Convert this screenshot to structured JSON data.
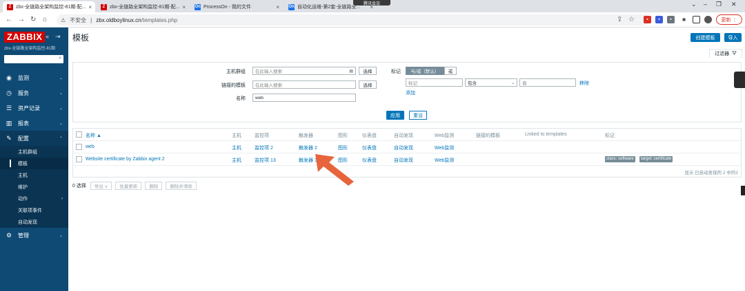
{
  "browser": {
    "tabs": [
      {
        "title": "zbx-全链路全架构监控-81期-配...",
        "favicon": "Z",
        "color": "#d40000"
      },
      {
        "title": "zbx-全链路全架构监控-81期-配...",
        "favicon": "Z",
        "color": "#d40000"
      },
      {
        "title": "ProcessOn - 我的文件",
        "favicon": "On",
        "color": "#1a73e8"
      },
      {
        "title": "自动化运维-第2套-全链路全...",
        "favicon": "On",
        "color": "#1a73e8"
      }
    ],
    "meeting_label": "腾讯会议",
    "insecure_label": "不安全",
    "url_domain": "zbx.oldboylinux.cn",
    "url_path": "/templates.php",
    "update_label": "更新"
  },
  "sidebar": {
    "logo": "ZABBIX",
    "subtitle": "zbx-全链路全架构监控-81期",
    "menu": [
      {
        "label": "监测",
        "icon": "eye-icon"
      },
      {
        "label": "服务",
        "icon": "clock-icon"
      },
      {
        "label": "资产记录",
        "icon": "list-icon"
      },
      {
        "label": "报表",
        "icon": "chart-icon"
      },
      {
        "label": "配置",
        "icon": "wrench-icon"
      }
    ],
    "submenu": [
      "主机群组",
      "模板",
      "主机",
      "维护",
      "动作",
      "关联项事件",
      "自动发现"
    ],
    "admin": {
      "label": "管理",
      "icon": "gear-icon"
    }
  },
  "page": {
    "title": "模板",
    "create_button": "创建模板",
    "import_button": "导入",
    "filter_tab": "过滤器"
  },
  "filter": {
    "host_groups_label": "主机群组",
    "host_groups_placeholder": "在此输入搜索",
    "linked_templates_label": "链接的模板",
    "linked_templates_placeholder": "在此输入搜索",
    "select_button": "选择",
    "name_label": "名称",
    "name_value": "web",
    "tags_label": "标记",
    "and_or": "与/或（默认）",
    "or": "或",
    "tag_placeholder": "标记",
    "tag_operator": "包含",
    "value_placeholder": "值",
    "remove_link": "移除",
    "add_link": "添加",
    "apply_button": "应用",
    "reset_button": "重设"
  },
  "table": {
    "headers": [
      "名称 ▲",
      "主机",
      "监控项",
      "触发器",
      "图形",
      "仪表盘",
      "自动发现",
      "Web监测",
      "链接的模板",
      "Linked to templates",
      "标记"
    ],
    "rows": [
      {
        "name": "web",
        "hosts": "主机",
        "items": "监控项 2",
        "triggers": "触发器 2",
        "graphs": "图形",
        "dashboards": "仪表盘",
        "discovery": "自动发现",
        "web": "Web监测",
        "tags": []
      },
      {
        "name": "Website certificate by Zabbix agent 2",
        "hosts": "主机",
        "items": "监控项 13",
        "triggers": "触发器 3",
        "graphs": "图形",
        "dashboards": "仪表盘",
        "discovery": "自动发现",
        "web": "Web监测",
        "tags": [
          "class: software",
          "target: certificate"
        ]
      }
    ],
    "showing": "显示 已自动发现的 2 中的2"
  },
  "bulk": {
    "selected": "0 选择",
    "buttons": [
      "导出 ∨",
      "批量更新",
      "删除",
      "删除并清除"
    ]
  },
  "colors": {
    "accent": "#0275b8",
    "sidebar": "#0f4a75",
    "arrow": "#e8643c"
  }
}
